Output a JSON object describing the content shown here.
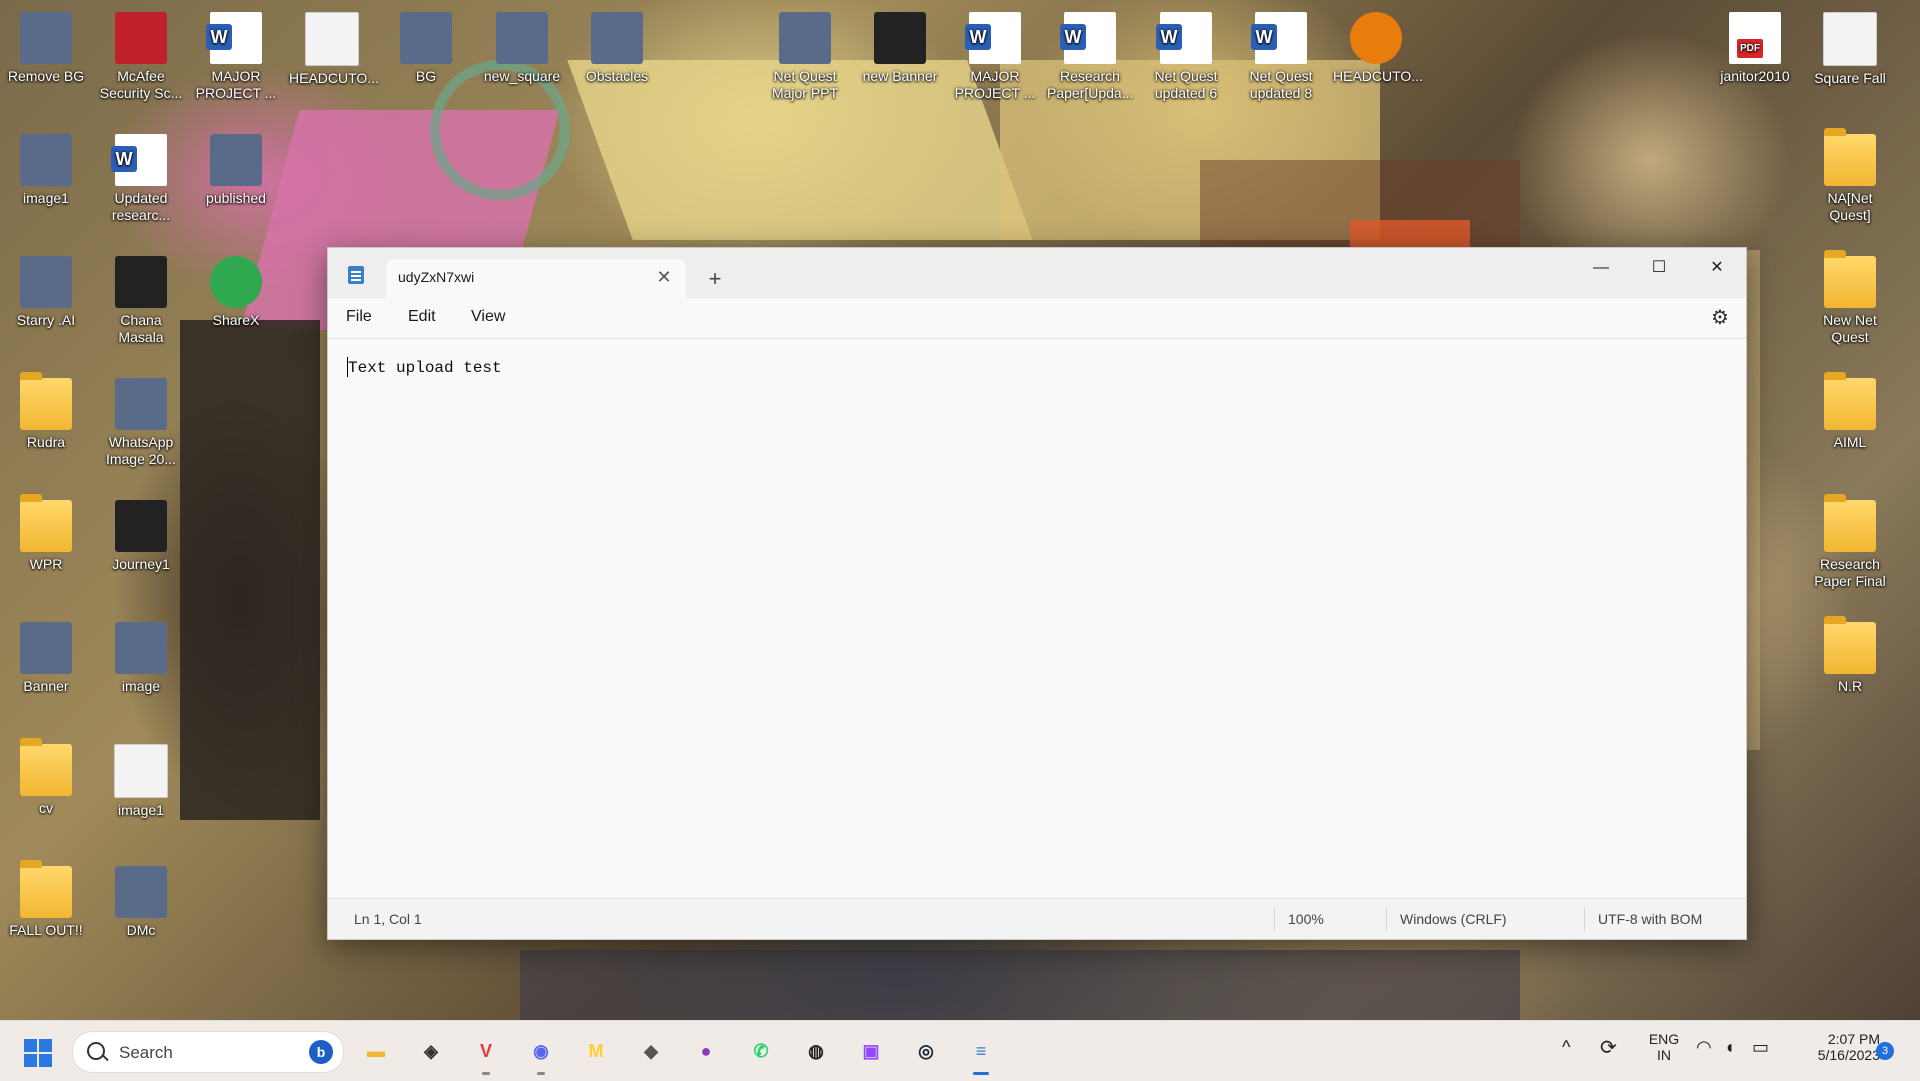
{
  "desktop": {
    "icons": [
      {
        "label": "Remove BG",
        "icon": "image-icon"
      },
      {
        "label": "McAfee Security Sc...",
        "icon": "mcafee-icon"
      },
      {
        "label": "MAJOR PROJECT ...",
        "icon": "word-doc-icon"
      },
      {
        "label": "HEADCUTO...",
        "icon": "file-icon"
      },
      {
        "label": "BG",
        "icon": "image-icon"
      },
      {
        "label": "new_square",
        "icon": "image-icon"
      },
      {
        "label": "Obstacles",
        "icon": "image-icon"
      },
      {
        "label": "Net Quest Major PPT",
        "icon": "image-icon"
      },
      {
        "label": "new Banner",
        "icon": "inkscape-icon"
      },
      {
        "label": "MAJOR PROJECT ...",
        "icon": "word-doc-icon"
      },
      {
        "label": "Research Paper[Upda...",
        "icon": "word-doc-icon"
      },
      {
        "label": "Net Quest updated 6",
        "icon": "word-doc-icon"
      },
      {
        "label": "Net Quest updated 8",
        "icon": "word-doc-icon"
      },
      {
        "label": "HEADCUTO...",
        "icon": "blender-icon"
      },
      {
        "label": "janitor2010",
        "icon": "pdf-icon"
      },
      {
        "label": "Square Fall",
        "icon": "file-icon"
      },
      {
        "label": "image1",
        "icon": "image-icon"
      },
      {
        "label": "Updated researc...",
        "icon": "word-doc-icon"
      },
      {
        "label": "published",
        "icon": "image-icon"
      },
      {
        "label": "NA[Net Quest]",
        "icon": "folder-icon"
      },
      {
        "label": "Starry .AI",
        "icon": "image-icon"
      },
      {
        "label": "Chana Masala",
        "icon": "inkscape-icon"
      },
      {
        "label": "ShareX",
        "icon": "sharex-icon"
      },
      {
        "label": "New Net Quest",
        "icon": "folder-icon"
      },
      {
        "label": "Rudra",
        "icon": "folder-icon"
      },
      {
        "label": "WhatsApp Image 20...",
        "icon": "image-icon"
      },
      {
        "label": "AIML",
        "icon": "folder-icon"
      },
      {
        "label": "WPR",
        "icon": "folder-icon"
      },
      {
        "label": "Journey1",
        "icon": "inkscape-icon"
      },
      {
        "label": "Research Paper Final",
        "icon": "folder-icon"
      },
      {
        "label": "Banner",
        "icon": "image-icon"
      },
      {
        "label": "image",
        "icon": "image-icon"
      },
      {
        "label": "N.R",
        "icon": "folder-icon"
      },
      {
        "label": "cv",
        "icon": "folder-icon"
      },
      {
        "label": "image1",
        "icon": "file-icon"
      },
      {
        "label": "FALL OUT!!",
        "icon": "folder-icon"
      },
      {
        "label": "DMc",
        "icon": "image-icon"
      }
    ]
  },
  "notepad": {
    "tab_title": "udyZxN7xwi",
    "close_tab": "✕",
    "new_tab": "+",
    "minimize": "—",
    "maximize": "☐",
    "close": "✕",
    "menu": {
      "file": "File",
      "edit": "Edit",
      "view": "View"
    },
    "settings_icon": "⚙",
    "content": "Text upload test",
    "status": {
      "position": "Ln 1, Col 1",
      "zoom": "100%",
      "line_ending": "Windows (CRLF)",
      "encoding": "UTF-8 with BOM"
    }
  },
  "taskbar": {
    "search_placeholder": "Search",
    "bing_label": "b",
    "apps": [
      {
        "name": "file-explorer-icon",
        "glyph": "▬",
        "color": "#f2b632"
      },
      {
        "name": "unity-icon",
        "glyph": "◈",
        "color": "#333333"
      },
      {
        "name": "vivaldi-icon",
        "glyph": "V",
        "color": "#e03c3c"
      },
      {
        "name": "discord-icon",
        "glyph": "◉",
        "color": "#5865f2"
      },
      {
        "name": "miro-icon",
        "glyph": "M",
        "color": "#ffd02f"
      },
      {
        "name": "layers-icon",
        "glyph": "◆",
        "color": "#555555"
      },
      {
        "name": "github-icon",
        "glyph": "●",
        "color": "#8a3ab9"
      },
      {
        "name": "whatsapp-icon",
        "glyph": "✆",
        "color": "#25d366"
      },
      {
        "name": "obs-icon",
        "glyph": "◍",
        "color": "#222222"
      },
      {
        "name": "twitch-icon",
        "glyph": "▣",
        "color": "#9146ff"
      },
      {
        "name": "steam-icon",
        "glyph": "◎",
        "color": "#1b2838"
      },
      {
        "name": "notepad-icon",
        "glyph": "≡",
        "color": "#3b7fc4"
      }
    ],
    "tray": {
      "chevron": "^",
      "lang_line1": "ENG",
      "lang_line2": "IN",
      "time": "2:07 PM",
      "date": "5/16/2023",
      "notifications": "3"
    }
  }
}
